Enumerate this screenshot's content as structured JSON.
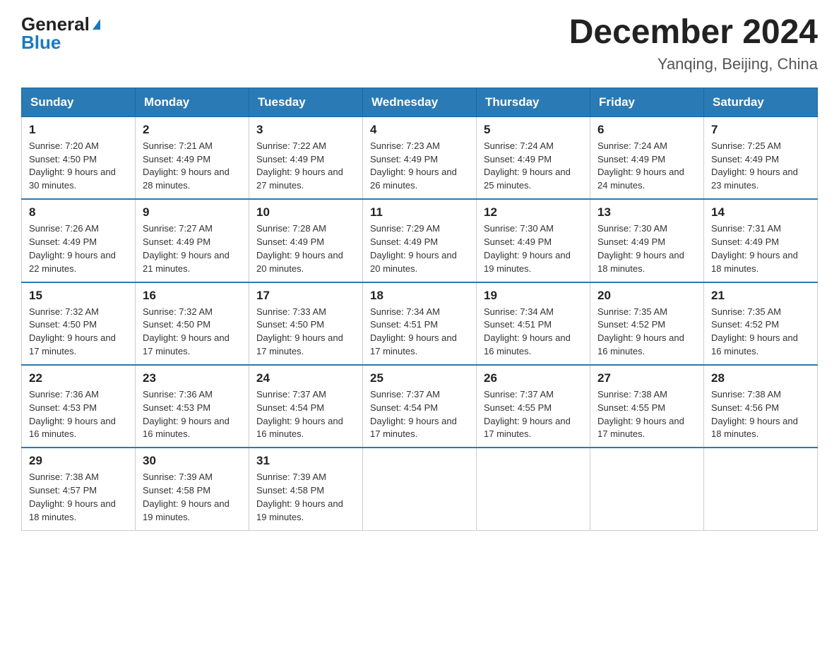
{
  "header": {
    "logo_line1": "General",
    "logo_line2": "Blue",
    "month_title": "December 2024",
    "location": "Yanqing, Beijing, China"
  },
  "weekdays": [
    "Sunday",
    "Monday",
    "Tuesday",
    "Wednesday",
    "Thursday",
    "Friday",
    "Saturday"
  ],
  "weeks": [
    [
      {
        "day": "1",
        "sunrise": "7:20 AM",
        "sunset": "4:50 PM",
        "daylight": "9 hours and 30 minutes."
      },
      {
        "day": "2",
        "sunrise": "7:21 AM",
        "sunset": "4:49 PM",
        "daylight": "9 hours and 28 minutes."
      },
      {
        "day": "3",
        "sunrise": "7:22 AM",
        "sunset": "4:49 PM",
        "daylight": "9 hours and 27 minutes."
      },
      {
        "day": "4",
        "sunrise": "7:23 AM",
        "sunset": "4:49 PM",
        "daylight": "9 hours and 26 minutes."
      },
      {
        "day": "5",
        "sunrise": "7:24 AM",
        "sunset": "4:49 PM",
        "daylight": "9 hours and 25 minutes."
      },
      {
        "day": "6",
        "sunrise": "7:24 AM",
        "sunset": "4:49 PM",
        "daylight": "9 hours and 24 minutes."
      },
      {
        "day": "7",
        "sunrise": "7:25 AM",
        "sunset": "4:49 PM",
        "daylight": "9 hours and 23 minutes."
      }
    ],
    [
      {
        "day": "8",
        "sunrise": "7:26 AM",
        "sunset": "4:49 PM",
        "daylight": "9 hours and 22 minutes."
      },
      {
        "day": "9",
        "sunrise": "7:27 AM",
        "sunset": "4:49 PM",
        "daylight": "9 hours and 21 minutes."
      },
      {
        "day": "10",
        "sunrise": "7:28 AM",
        "sunset": "4:49 PM",
        "daylight": "9 hours and 20 minutes."
      },
      {
        "day": "11",
        "sunrise": "7:29 AM",
        "sunset": "4:49 PM",
        "daylight": "9 hours and 20 minutes."
      },
      {
        "day": "12",
        "sunrise": "7:30 AM",
        "sunset": "4:49 PM",
        "daylight": "9 hours and 19 minutes."
      },
      {
        "day": "13",
        "sunrise": "7:30 AM",
        "sunset": "4:49 PM",
        "daylight": "9 hours and 18 minutes."
      },
      {
        "day": "14",
        "sunrise": "7:31 AM",
        "sunset": "4:49 PM",
        "daylight": "9 hours and 18 minutes."
      }
    ],
    [
      {
        "day": "15",
        "sunrise": "7:32 AM",
        "sunset": "4:50 PM",
        "daylight": "9 hours and 17 minutes."
      },
      {
        "day": "16",
        "sunrise": "7:32 AM",
        "sunset": "4:50 PM",
        "daylight": "9 hours and 17 minutes."
      },
      {
        "day": "17",
        "sunrise": "7:33 AM",
        "sunset": "4:50 PM",
        "daylight": "9 hours and 17 minutes."
      },
      {
        "day": "18",
        "sunrise": "7:34 AM",
        "sunset": "4:51 PM",
        "daylight": "9 hours and 17 minutes."
      },
      {
        "day": "19",
        "sunrise": "7:34 AM",
        "sunset": "4:51 PM",
        "daylight": "9 hours and 16 minutes."
      },
      {
        "day": "20",
        "sunrise": "7:35 AM",
        "sunset": "4:52 PM",
        "daylight": "9 hours and 16 minutes."
      },
      {
        "day": "21",
        "sunrise": "7:35 AM",
        "sunset": "4:52 PM",
        "daylight": "9 hours and 16 minutes."
      }
    ],
    [
      {
        "day": "22",
        "sunrise": "7:36 AM",
        "sunset": "4:53 PM",
        "daylight": "9 hours and 16 minutes."
      },
      {
        "day": "23",
        "sunrise": "7:36 AM",
        "sunset": "4:53 PM",
        "daylight": "9 hours and 16 minutes."
      },
      {
        "day": "24",
        "sunrise": "7:37 AM",
        "sunset": "4:54 PM",
        "daylight": "9 hours and 16 minutes."
      },
      {
        "day": "25",
        "sunrise": "7:37 AM",
        "sunset": "4:54 PM",
        "daylight": "9 hours and 17 minutes."
      },
      {
        "day": "26",
        "sunrise": "7:37 AM",
        "sunset": "4:55 PM",
        "daylight": "9 hours and 17 minutes."
      },
      {
        "day": "27",
        "sunrise": "7:38 AM",
        "sunset": "4:55 PM",
        "daylight": "9 hours and 17 minutes."
      },
      {
        "day": "28",
        "sunrise": "7:38 AM",
        "sunset": "4:56 PM",
        "daylight": "9 hours and 18 minutes."
      }
    ],
    [
      {
        "day": "29",
        "sunrise": "7:38 AM",
        "sunset": "4:57 PM",
        "daylight": "9 hours and 18 minutes."
      },
      {
        "day": "30",
        "sunrise": "7:39 AM",
        "sunset": "4:58 PM",
        "daylight": "9 hours and 19 minutes."
      },
      {
        "day": "31",
        "sunrise": "7:39 AM",
        "sunset": "4:58 PM",
        "daylight": "9 hours and 19 minutes."
      },
      null,
      null,
      null,
      null
    ]
  ]
}
